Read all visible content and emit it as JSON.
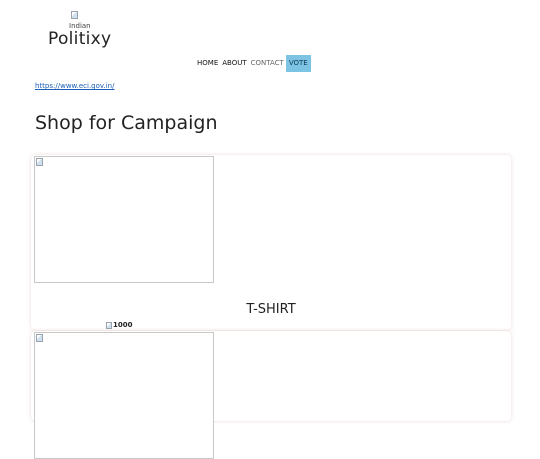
{
  "header": {
    "logo_alt": "Indian",
    "brand": "Politixy"
  },
  "nav": {
    "items": [
      {
        "label": "HOME"
      },
      {
        "label": "ABOUT"
      },
      {
        "label": "CONTACT"
      },
      {
        "label": "VOTE"
      }
    ],
    "active": "VOTE",
    "active_color": "#7dc4e4"
  },
  "link": {
    "text": "https://www.eci.gov.in/"
  },
  "main": {
    "title": "Shop for Campaign",
    "products": [
      {
        "name": "T-SHIRT",
        "price": "1000"
      },
      {
        "name": "",
        "price": ""
      }
    ]
  }
}
